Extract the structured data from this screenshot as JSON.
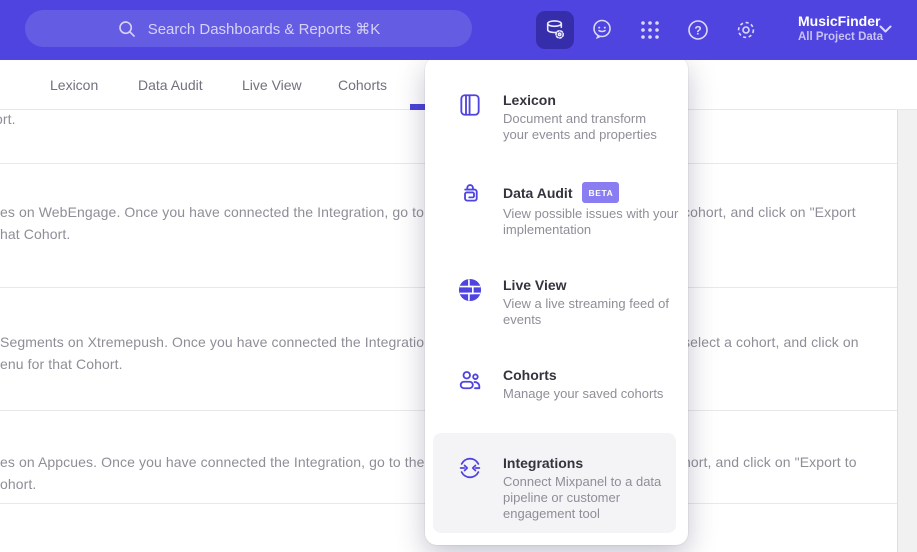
{
  "header": {
    "search": {
      "placeholder": "Search Dashboards & Reports ⌘K"
    },
    "project": {
      "name": "MusicFinder",
      "subtitle": "All Project Data"
    }
  },
  "tabs": {
    "items": [
      {
        "label": "Lexicon"
      },
      {
        "label": "Data Audit"
      },
      {
        "label": "Live View"
      },
      {
        "label": "Cohorts"
      }
    ]
  },
  "menu": {
    "items": [
      {
        "title": "Lexicon",
        "desc": "Document and transform\nyour events and properties"
      },
      {
        "title": "Data Audit",
        "badge": "BETA",
        "desc": "View possible issues with your\nimplementation"
      },
      {
        "title": "Live View",
        "desc": "View a live streaming feed of\nevents"
      },
      {
        "title": "Cohorts",
        "desc": "Manage your saved cohorts"
      },
      {
        "title": "Integrations",
        "desc": "Connect Mixpanel to a data\npipeline or customer\nengagement tool",
        "highlighted": true
      }
    ]
  },
  "background": {
    "row_tail": "ort.",
    "rows": [
      {
        "line1_left": "es on WebEngage. Once you have connected the Integration, go to the",
        "line1_right": "cohort, and click on \"Export",
        "line2": "hat Cohort."
      },
      {
        "line1_left": "Segments on Xtremepush. Once you have connected the Integration,",
        "line1_right": "select a cohort, and click on",
        "line2": "enu for that Cohort."
      },
      {
        "line1_left": "es on Appcues. Once you have connected the Integration, go to the M",
        "line1_right": "hort, and click on \"Export to",
        "line2": "ohort."
      }
    ]
  },
  "colors": {
    "header_bg": "#4f44e0",
    "accent": "#4f44e0",
    "tab_indicator": "#4b42d9",
    "badge_bg": "#8a7df1",
    "highlight_bg": "#f4f4f6"
  }
}
